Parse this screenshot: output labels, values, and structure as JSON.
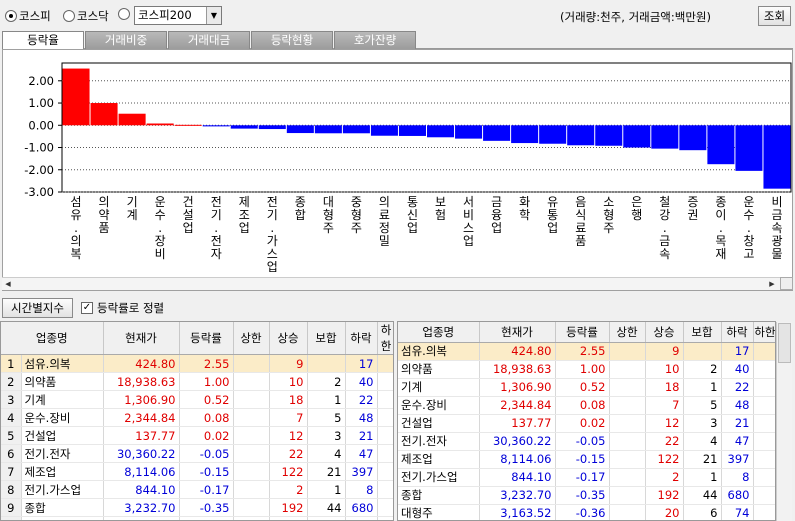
{
  "market_options": [
    {
      "label": "코스피",
      "selected": true
    },
    {
      "label": "코스닥",
      "selected": false
    },
    {
      "label": "",
      "selected": false
    }
  ],
  "index_select": "코스피200",
  "units_note": "(거래량:천주, 거래금액:백만원)",
  "lookup_button": "조회",
  "tabs": [
    "등락율",
    "거래비중",
    "거래대금",
    "등락현황",
    "호가잔량"
  ],
  "active_tab": 0,
  "chart_data": {
    "type": "bar",
    "categories": [
      "섬유.의복",
      "의약품",
      "기계",
      "운수.장비",
      "건설업",
      "전기.전자",
      "제조업",
      "전기.가스업",
      "종합",
      "대형주",
      "중형주",
      "의료정밀",
      "통신업",
      "보험",
      "서비스업",
      "금융업",
      "화학",
      "유통업",
      "음식료품",
      "소형주",
      "은행",
      "철강.금속",
      "증권",
      "종이.목재",
      "운수.창고",
      "비금속광물"
    ],
    "values": [
      2.55,
      1.0,
      0.52,
      0.08,
      0.02,
      -0.05,
      -0.15,
      -0.17,
      -0.35,
      -0.36,
      -0.36,
      -0.47,
      -0.48,
      -0.54,
      -0.6,
      -0.7,
      -0.8,
      -0.83,
      -0.9,
      -0.92,
      -1.0,
      -1.05,
      -1.12,
      -1.75,
      -2.05,
      -2.85
    ],
    "yticks": [
      "2.00",
      "1.00",
      "0.00",
      "-1.00",
      "-2.00",
      "-3.00"
    ],
    "ylim": [
      -3.0,
      2.8
    ],
    "colors": {
      "up": "#ff0000",
      "down": "#0000ff"
    }
  },
  "time_button": "시간별지수",
  "sort_checkbox": {
    "label": "등락률로 정렬",
    "checked": true
  },
  "table_headers": [
    "업종명",
    "현재가",
    "등락률",
    "상한",
    "상승",
    "보합",
    "하락",
    "하한"
  ],
  "rows": [
    {
      "no": "1",
      "name": "섬유.의복",
      "price": "424.80",
      "rate": "2.55",
      "upper": "",
      "up": "9",
      "flat": "",
      "down": "17",
      "lower": "",
      "dir": "up"
    },
    {
      "no": "2",
      "name": "의약품",
      "price": "18,938.63",
      "rate": "1.00",
      "upper": "",
      "up": "10",
      "flat": "2",
      "down": "40",
      "lower": "",
      "dir": "up"
    },
    {
      "no": "3",
      "name": "기계",
      "price": "1,306.90",
      "rate": "0.52",
      "upper": "",
      "up": "18",
      "flat": "1",
      "down": "22",
      "lower": "",
      "dir": "up"
    },
    {
      "no": "4",
      "name": "운수.장비",
      "price": "2,344.84",
      "rate": "0.08",
      "upper": "",
      "up": "7",
      "flat": "5",
      "down": "48",
      "lower": "",
      "dir": "up"
    },
    {
      "no": "5",
      "name": "건설업",
      "price": "137.77",
      "rate": "0.02",
      "upper": "",
      "up": "12",
      "flat": "3",
      "down": "21",
      "lower": "",
      "dir": "up"
    },
    {
      "no": "6",
      "name": "전기.전자",
      "price": "30,360.22",
      "rate": "-0.05",
      "upper": "",
      "up": "22",
      "flat": "4",
      "down": "47",
      "lower": "",
      "dir": "down"
    },
    {
      "no": "7",
      "name": "제조업",
      "price": "8,114.06",
      "rate": "-0.15",
      "upper": "",
      "up": "122",
      "flat": "21",
      "down": "397",
      "lower": "",
      "dir": "down"
    },
    {
      "no": "8",
      "name": "전기.가스업",
      "price": "844.10",
      "rate": "-0.17",
      "upper": "",
      "up": "2",
      "flat": "1",
      "down": "8",
      "lower": "",
      "dir": "down"
    },
    {
      "no": "9",
      "name": "종합",
      "price": "3,232.70",
      "rate": "-0.35",
      "upper": "",
      "up": "192",
      "flat": "44",
      "down": "680",
      "lower": "",
      "dir": "down"
    },
    {
      "no": "10",
      "name": "대형주",
      "price": "3,163.52",
      "rate": "-0.36",
      "upper": "",
      "up": "20",
      "flat": "6",
      "down": "74",
      "lower": "",
      "dir": "down"
    }
  ]
}
